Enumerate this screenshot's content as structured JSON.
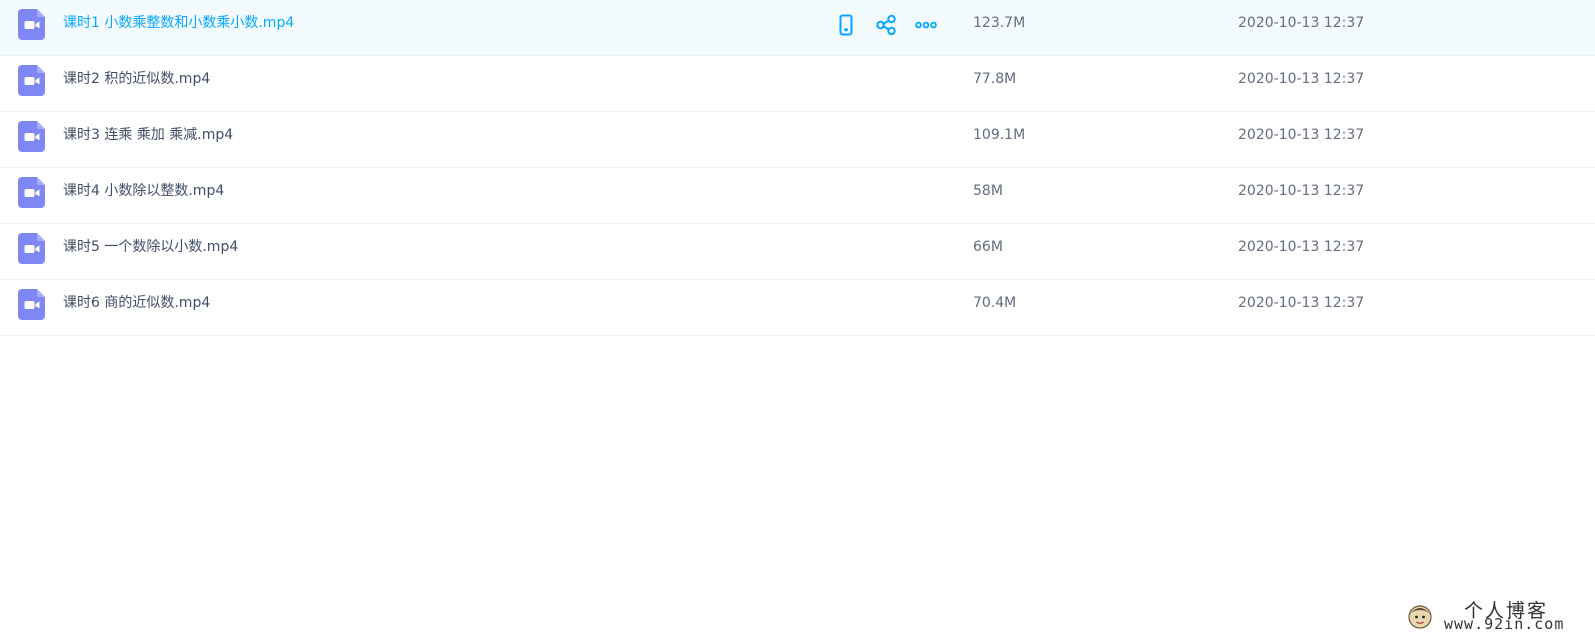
{
  "colors": {
    "accent": "#06a7ff",
    "file_icon": "#7f87f6",
    "text": "#424e67",
    "muted": "#636d7e",
    "hover_row_bg": "#f4fbff"
  },
  "row_actions": {
    "icons": [
      "phone-icon",
      "share-icon",
      "more-icon"
    ]
  },
  "files": [
    {
      "name": "课时1 小数乘整数和小数乘小数.mp4",
      "size": "123.7M",
      "date": "2020-10-13 12:37",
      "icon": "video-file-icon"
    },
    {
      "name": "课时2 积的近似数.mp4",
      "size": "77.8M",
      "date": "2020-10-13 12:37",
      "icon": "video-file-icon"
    },
    {
      "name": "课时3 连乘 乘加 乘减.mp4",
      "size": "109.1M",
      "date": "2020-10-13 12:37",
      "icon": "video-file-icon"
    },
    {
      "name": "课时4 小数除以整数.mp4",
      "size": "58M",
      "date": "2020-10-13 12:37",
      "icon": "video-file-icon"
    },
    {
      "name": "课时5 一个数除以小数.mp4",
      "size": "66M",
      "date": "2020-10-13 12:37",
      "icon": "video-file-icon"
    },
    {
      "name": "课时6 商的近似数.mp4",
      "size": "70.4M",
      "date": "2020-10-13 12:37",
      "icon": "video-file-icon"
    }
  ],
  "watermark": {
    "title": "个人博客",
    "url": "www.92in.com",
    "avatar_icon": "avatar-icon"
  }
}
